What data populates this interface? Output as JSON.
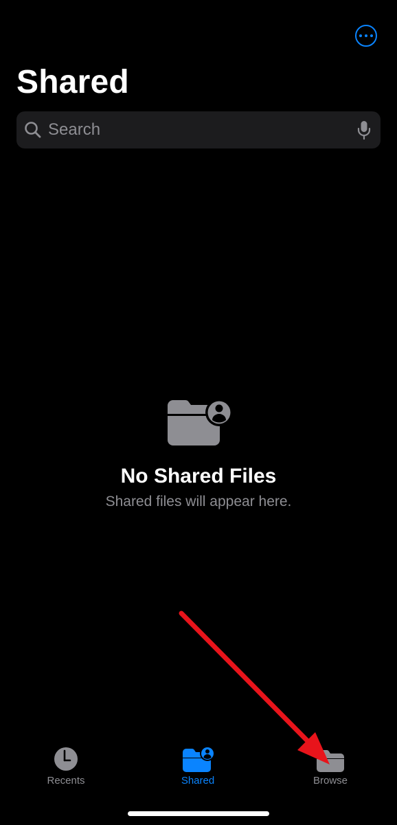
{
  "header": {
    "title": "Shared",
    "more_icon": "ellipsis-circle-icon"
  },
  "search": {
    "placeholder": "Search",
    "icon": "search-icon",
    "mic_icon": "microphone-icon"
  },
  "empty_state": {
    "icon": "shared-folder-icon",
    "title": "No Shared Files",
    "subtitle": "Shared files will appear here."
  },
  "tab_bar": {
    "tabs": [
      {
        "label": "Recents",
        "icon": "clock-icon",
        "selected": false
      },
      {
        "label": "Shared",
        "icon": "shared-folder-icon",
        "selected": true
      },
      {
        "label": "Browse",
        "icon": "folder-icon",
        "selected": false
      }
    ]
  },
  "colors": {
    "background": "#000000",
    "accent": "#0a84ff",
    "secondary_text": "#8e8e93",
    "search_field": "#1c1c1e",
    "annotation_arrow": "#e8141b"
  },
  "annotation": {
    "type": "red-arrow",
    "target": "Browse"
  }
}
